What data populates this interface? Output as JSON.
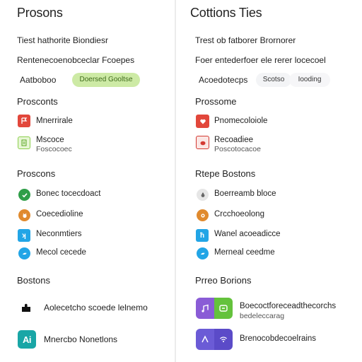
{
  "left": {
    "title": "Prosons",
    "line1": "Tiest hathorite Biondiesr",
    "line2": "Rentenecoenobceclar Fcoepes",
    "line3": "Aatboboo",
    "pill": "Doersed Gooltse",
    "sec1": {
      "title": "Prosconts",
      "items": [
        {
          "label": "Mnerrirale",
          "icon": "flag-icon",
          "color": "#e2473b"
        },
        {
          "label": "Mscoce",
          "sub": "Foscocoec",
          "icon": "document-icon",
          "color": "#8ccf4d"
        }
      ]
    },
    "sec2": {
      "title": "Proscons",
      "items": [
        {
          "label": "Bonec tocecdoact",
          "icon": "check-icon",
          "color": "#2f9e48"
        },
        {
          "label": "Coecedioline",
          "icon": "cat-icon",
          "color": "#e08a2e"
        },
        {
          "label": "Neconmtiers",
          "icon": "k-icon",
          "color": "#22a5e6"
        },
        {
          "label": "Mecol cecede",
          "icon": "bird-icon",
          "color": "#22a5e6"
        }
      ]
    },
    "sec3": {
      "title": "Bostons",
      "items": [
        {
          "label": "Aolecetcho scoede lelnemo",
          "icon": "puzzle-icon",
          "color": "#111111"
        },
        {
          "label": "Mnercbo Nonetlons",
          "icon": "ai-icon",
          "color": "#19a6a6"
        }
      ]
    }
  },
  "right": {
    "title": "Cottions Ties",
    "line1": "Trest ob fatborer Brornorer",
    "line2": "Foer entederfoer ele rerer locecoel",
    "line3": "Acoedotecps",
    "pill1": "Scotso",
    "pill2": "Iooding",
    "sec1": {
      "title": "Prossome",
      "items": [
        {
          "label": "Pnomecoloiole",
          "icon": "heart-icon",
          "color": "#e2473b"
        },
        {
          "label": "Recoadiee",
          "sub": "Poscotocacoe",
          "icon": "stamp-icon",
          "color": "#d43a33"
        }
      ]
    },
    "sec2": {
      "title": "Rtepe Bostons",
      "items": [
        {
          "label": "Boerreamb bloce",
          "icon": "bug-icon",
          "color": "#888888"
        },
        {
          "label": "Crcchoeolong",
          "icon": "lion-icon",
          "color": "#e08a2e"
        },
        {
          "label": "Wanel acoeadicce",
          "icon": "book-icon",
          "color": "#22a5e6"
        },
        {
          "label": "Merneal ceedme",
          "icon": "bird-icon",
          "color": "#22a5e6"
        }
      ]
    },
    "sec3": {
      "title": "Prreo Borions",
      "items": [
        {
          "label": "Boecoctforeceadthecorchs",
          "sub": "bedeleccarag",
          "icon": "music-icon",
          "color": "#8a5cd6"
        },
        {
          "label": "Brenocobdecoelrains",
          "icon": "wave-icon",
          "color": "#6b5bd6"
        }
      ]
    }
  }
}
